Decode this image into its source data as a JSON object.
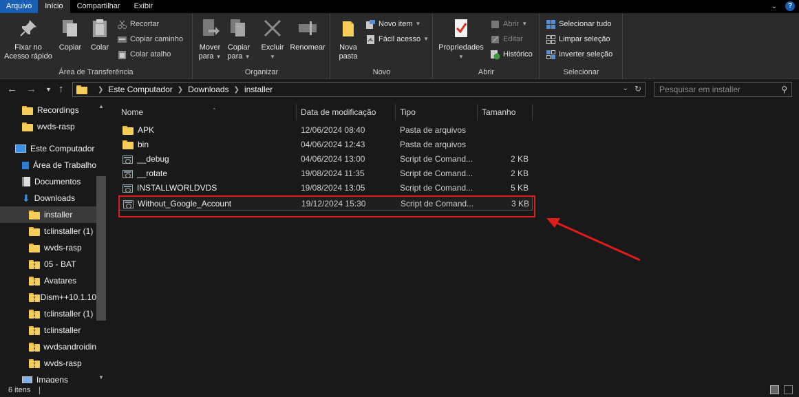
{
  "ribbon_tabs": [
    "Arquivo",
    "Início",
    "Compartilhar",
    "Exibir"
  ],
  "ribbon": {
    "clipboard": {
      "pin_label_1": "Fixar no",
      "pin_label_2": "Acesso rápido",
      "copy": "Copiar",
      "paste": "Colar",
      "cut": "Recortar",
      "copy_path": "Copiar caminho",
      "paste_shortcut": "Colar atalho",
      "group": "Área de Transferência"
    },
    "organize": {
      "move_1": "Mover",
      "move_2": "para",
      "copy_1": "Copiar",
      "copy_2": "para",
      "delete": "Excluir",
      "rename": "Renomear",
      "group": "Organizar"
    },
    "new": {
      "folder_1": "Nova",
      "folder_2": "pasta",
      "new_item": "Novo item",
      "easy_access": "Fácil acesso",
      "group": "Novo"
    },
    "open": {
      "properties": "Propriedades",
      "open": "Abrir",
      "edit": "Editar",
      "history": "Histórico",
      "group": "Abrir"
    },
    "select": {
      "select_all": "Selecionar tudo",
      "clear": "Limpar seleção",
      "invert": "Inverter seleção",
      "group": "Selecionar"
    }
  },
  "address": {
    "crumbs": [
      "Este Computador",
      "Downloads",
      "installer"
    ],
    "search_placeholder": "Pesquisar em installer"
  },
  "nav": {
    "items": [
      "Recordings",
      "wvds-rasp",
      "Este Computador",
      "Área de Trabalho",
      "Documentos",
      "Downloads",
      "installer",
      "tclinstaller (1)",
      "wvds-rasp",
      "05 - BAT",
      "Avatares",
      "Dism++10.1.10",
      "tclinstaller (1)",
      "tclinstaller",
      "wvdsandroidin",
      "wvds-rasp",
      "Imagens"
    ]
  },
  "columns": {
    "name": "Nome",
    "date": "Data de modificação",
    "type": "Tipo",
    "size": "Tamanho"
  },
  "files": [
    {
      "name": "APK",
      "date": "12/06/2024 08:40",
      "type": "Pasta de arquivos",
      "size": ""
    },
    {
      "name": "bin",
      "date": "04/06/2024 12:43",
      "type": "Pasta de arquivos",
      "size": ""
    },
    {
      "name": "__debug",
      "date": "04/06/2024 13:00",
      "type": "Script de Comand...",
      "size": "2 KB"
    },
    {
      "name": "__rotate",
      "date": "19/08/2024 11:35",
      "type": "Script de Comand...",
      "size": "2 KB"
    },
    {
      "name": "INSTALLWORLDVDS",
      "date": "19/08/2024 13:05",
      "type": "Script de Comand...",
      "size": "5 KB"
    },
    {
      "name": "Without_Google_Account",
      "date": "19/12/2024 15:30",
      "type": "Script de Comand...",
      "size": "3 KB"
    }
  ],
  "status": {
    "count": "6 itens"
  },
  "colors": {
    "accent": "#1a5fb4",
    "highlight": "#e01b1b",
    "folder": "#f7cd5a"
  }
}
